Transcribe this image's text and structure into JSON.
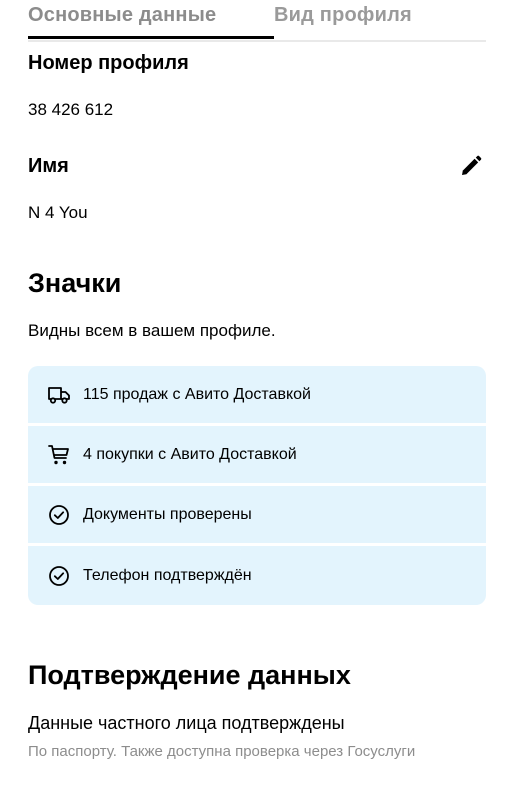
{
  "tabs": {
    "basic": "Основные данные",
    "profile_view": "Вид профиля"
  },
  "profile_number": {
    "label": "Номер профиля",
    "value": "38 426 612"
  },
  "name": {
    "label": "Имя",
    "value": "N 4 You",
    "edit_icon": "pencil-icon"
  },
  "badges": {
    "title": "Значки",
    "subtitle": "Видны всем в вашем профиле.",
    "background": "#e3f4fd",
    "items": [
      {
        "icon": "truck-icon",
        "text": "115 продаж с Авито Доставкой"
      },
      {
        "icon": "cart-icon",
        "text": "4 покупки с Авито Доставкой"
      },
      {
        "icon": "check-circle-icon",
        "text": "Документы проверены"
      },
      {
        "icon": "check-circle-icon",
        "text": "Телефон подтверждён"
      }
    ]
  },
  "confirmation": {
    "title": "Подтверждение данных",
    "status": "Данные частного лица подтверждены",
    "description": "По паспорту. Также доступна проверка через Госуслуги"
  }
}
